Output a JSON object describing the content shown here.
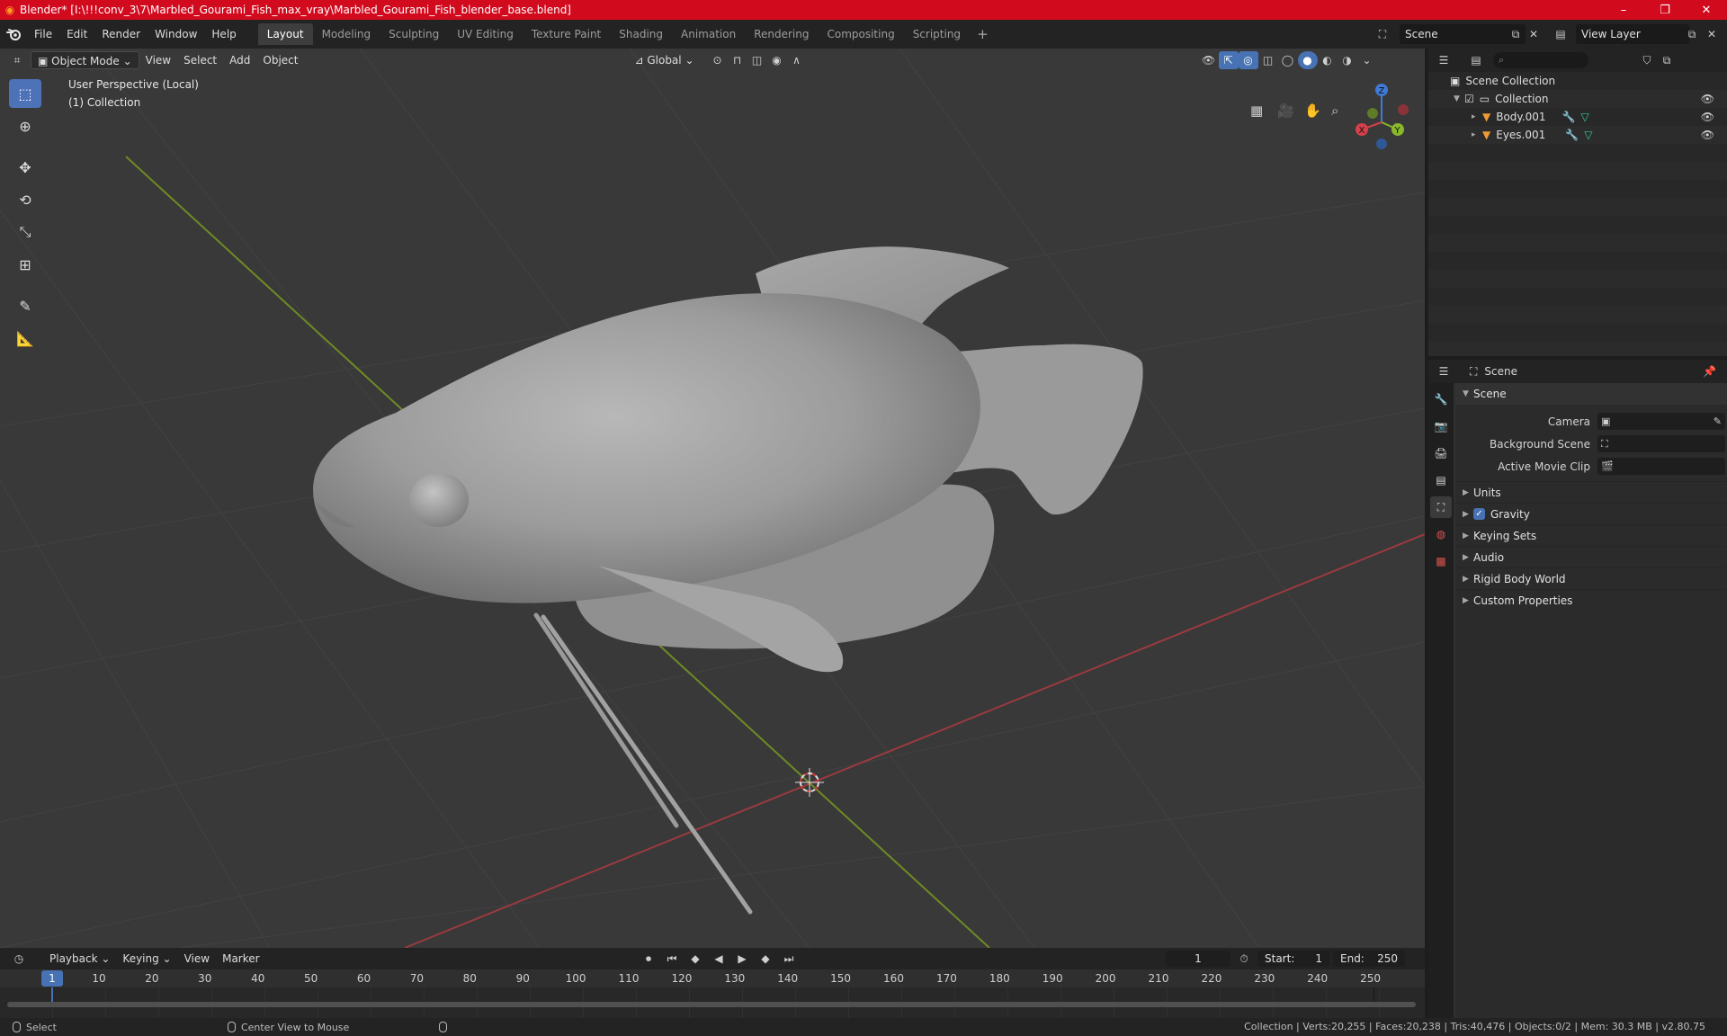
{
  "window": {
    "title": "Blender* [I:\\!!!conv_3\\7\\Marbled_Gourami_Fish_max_vray\\Marbled_Gourami_Fish_blender_base.blend]",
    "minimize": "–",
    "maximize": "❐",
    "close": "✕"
  },
  "menu": {
    "items": [
      "File",
      "Edit",
      "Render",
      "Window",
      "Help"
    ]
  },
  "workspaces": {
    "tabs": [
      "Layout",
      "Modeling",
      "Sculpting",
      "UV Editing",
      "Texture Paint",
      "Shading",
      "Animation",
      "Rendering",
      "Compositing",
      "Scripting"
    ],
    "active": "Layout",
    "add": "+"
  },
  "scene_selector": {
    "value": "Scene"
  },
  "view_layer_selector": {
    "value": "View Layer"
  },
  "viewport": {
    "mode": "Object Mode",
    "menus": [
      "View",
      "Select",
      "Add",
      "Object"
    ],
    "transform_orientation": "Global",
    "info_line1": "User Perspective (Local)",
    "info_line2": "(1) Collection",
    "gizmo": {
      "x": "X",
      "y": "Y",
      "z": "Z"
    }
  },
  "outliner": {
    "search_placeholder": "",
    "root": "Scene Collection",
    "collection": "Collection",
    "objects": [
      {
        "name": "Body.001"
      },
      {
        "name": "Eyes.001"
      }
    ]
  },
  "properties": {
    "context": "Scene",
    "panel_title": "Scene",
    "camera_label": "Camera",
    "background_scene_label": "Background Scene",
    "active_movie_clip_label": "Active Movie Clip",
    "subpanels": [
      "Units",
      "Gravity",
      "Keying Sets",
      "Audio",
      "Rigid Body World",
      "Custom Properties"
    ],
    "gravity_enabled": true
  },
  "timeline": {
    "menus": [
      "Playback",
      "Keying",
      "View",
      "Marker"
    ],
    "current_frame": "1",
    "start_label": "Start:",
    "start_value": "1",
    "end_label": "End:",
    "end_value": "250",
    "ruler_ticks": [
      "10",
      "20",
      "30",
      "40",
      "50",
      "60",
      "70",
      "80",
      "90",
      "100",
      "110",
      "120",
      "130",
      "140",
      "150",
      "160",
      "170",
      "180",
      "190",
      "200",
      "210",
      "220",
      "230",
      "240",
      "250"
    ],
    "playhead": "1"
  },
  "statusbar": {
    "select": "Select",
    "center_view": "Center View to Mouse",
    "stats": "Collection | Verts:20,255 | Faces:20,238 | Tris:40,476 | Objects:0/2 | Mem: 30.3 MB | v2.80.75"
  },
  "colors": {
    "title_bar": "#d20a1e",
    "accent_blue": "#4772b3",
    "x_axis": "#d6404b",
    "y_axis": "#8ab82a",
    "z_axis": "#3f7ad6",
    "mesh_icon": "#f09a37",
    "modifier_icon": "#6aa9f0",
    "vertex_icon": "#31c9a0"
  }
}
